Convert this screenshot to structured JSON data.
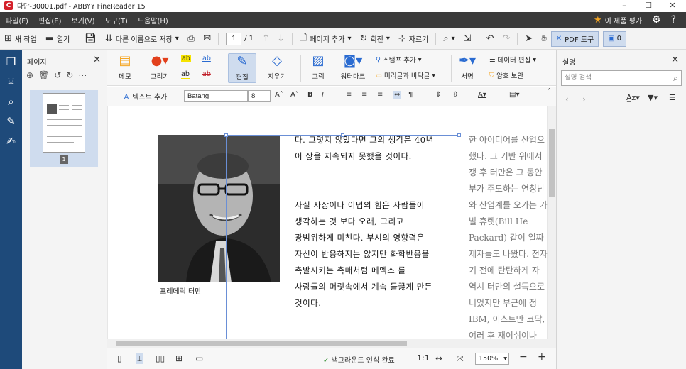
{
  "window": {
    "title": "다단-30001.pdf - ABBYY FineReader 15",
    "app_icon": "abbyy-app-icon",
    "controls": [
      "minimize-icon",
      "maximize-icon",
      "close-icon"
    ]
  },
  "menubar": {
    "items": [
      "파일(F)",
      "편집(E)",
      "보기(V)",
      "도구(T)",
      "도움말(H)"
    ],
    "rate_label": "이 제품 평가"
  },
  "toolbar": {
    "new_task": "새 작업",
    "open": "열기",
    "save_as": "다른 이름으로 저장",
    "page_current": "1",
    "page_total": "/ 1",
    "add_page": "페이지 추가",
    "rotate": "회전",
    "crop": "자르기",
    "pdf_tools": "PDF 도구",
    "comments_count": "0"
  },
  "pages_panel": {
    "title": "페이지",
    "thumb_number": "1"
  },
  "ribbon": {
    "memo": "메모",
    "draw": "그리기",
    "edit": "편집",
    "erase": "지우기",
    "image": "그림",
    "watermark": "워터마크",
    "stamp_add": "스탬프 추가",
    "header_footer": "머리글과 바닥글",
    "signature": "서명",
    "data_edit": "데이터 편집",
    "password": "암호 보안"
  },
  "format_bar": {
    "add_text": "텍스트 추가",
    "font": "Batang",
    "size": "8"
  },
  "document": {
    "caption": "프레데릭 터만",
    "column2": [
      "다. 그렇지 않았다면 그의 생각은 40년",
      "이 상을 지속되지 못했을 것이다.",
      "",
      "",
      "사실 사상이나 이념의 힘은 사람들이",
      "생각하는 것 보다 오래, 그리고",
      "광범위하게 미친다. 부시의 영향력은",
      "자신이 반응하지는 않지만 화학반응을",
      "촉발시키는 촉매처럼 메멕스 를",
      "사람들의 머릿속에서 계속 들끓게 만든",
      "것이다."
    ],
    "column3": [
      "한 아이디어를 산업으",
      "했다. 그 기반 위에서",
      "쟁 후 터만은 그 동안",
      "부가 주도하는 연칭난",
      "와 산업계를 오가는 가",
      "빌 휴렛(Bill He",
      "Packard) 같이 일짜",
      "제자들도 나왔다. 전자",
      "기 전에 탄탄하게 자",
      "역시 터만의 설득으로",
      "니었지만 부근에 정",
      "IBM, 이스트만 코닥,",
      "여러 후 재이쉬이나"
    ]
  },
  "status": {
    "background_ocr": "백그라운드 인식 완료",
    "ratio": "1:1",
    "zoom": "150%"
  },
  "right_panel": {
    "title": "설명",
    "search_placeholder": "설명 검색"
  }
}
